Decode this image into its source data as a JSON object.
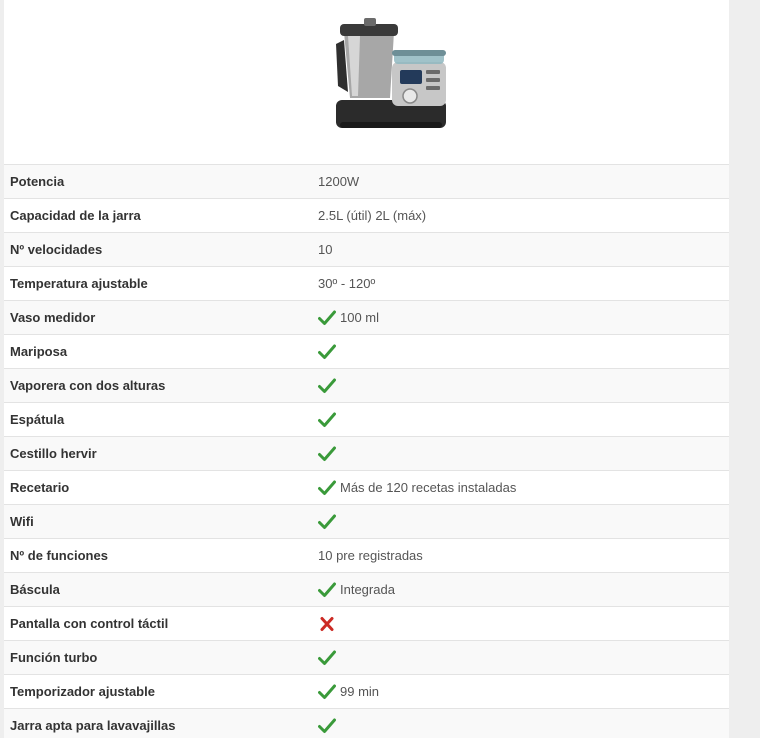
{
  "product": {
    "image_icon": "product-image"
  },
  "colors": {
    "check": "#3a9a3a",
    "cross": "#cc2a24"
  },
  "rows": [
    {
      "label": "Potencia",
      "icon": "",
      "value": "1200W"
    },
    {
      "label": "Capacidad de la jarra",
      "icon": "",
      "value": "2.5L (útil) 2L (máx)"
    },
    {
      "label": "Nº velocidades",
      "icon": "",
      "value": "10"
    },
    {
      "label": "Temperatura ajustable",
      "icon": "",
      "value": "30º - 120º"
    },
    {
      "label": "Vaso medidor",
      "icon": "check",
      "value": "100 ml"
    },
    {
      "label": "Mariposa",
      "icon": "check",
      "value": ""
    },
    {
      "label": "Vaporera con dos alturas",
      "icon": "check",
      "value": ""
    },
    {
      "label": "Espátula",
      "icon": "check",
      "value": ""
    },
    {
      "label": "Cestillo hervir",
      "icon": "check",
      "value": ""
    },
    {
      "label": "Recetario",
      "icon": "check",
      "value": "Más de 120 recetas instaladas"
    },
    {
      "label": "Wifi",
      "icon": "check",
      "value": ""
    },
    {
      "label": "Nº de funciones",
      "icon": "",
      "value": "10 pre registradas"
    },
    {
      "label": "Báscula",
      "icon": "check",
      "value": "Integrada"
    },
    {
      "label": "Pantalla con control táctil",
      "icon": "cross",
      "value": ""
    },
    {
      "label": "Función turbo",
      "icon": "check",
      "value": ""
    },
    {
      "label": "Temporizador ajustable",
      "icon": "check",
      "value": "99 min"
    },
    {
      "label": "Jarra apta para lavavajillas",
      "icon": "check",
      "value": ""
    }
  ]
}
